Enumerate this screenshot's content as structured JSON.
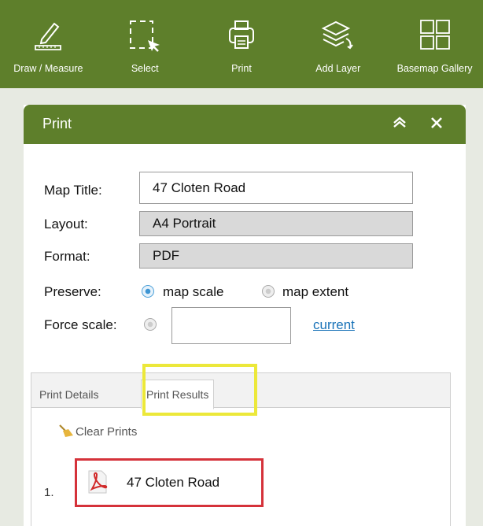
{
  "toolbar": {
    "items": [
      {
        "label": "Draw / Measure",
        "icon": "pencil-ruler-icon"
      },
      {
        "label": "Select",
        "icon": "select-cursor-icon"
      },
      {
        "label": "Print",
        "icon": "printer-icon"
      },
      {
        "label": "Add Layer",
        "icon": "layers-icon"
      },
      {
        "label": "Basemap Gallery",
        "icon": "grid-icon"
      }
    ]
  },
  "panel": {
    "title": "Print",
    "collapse_icon": "double-chevron-up-icon",
    "close_icon": "close-icon",
    "form": {
      "map_title_label": "Map Title:",
      "map_title_value": "47 Cloten Road",
      "layout_label": "Layout:",
      "layout_value": "A4 Portrait",
      "format_label": "Format:",
      "format_value": "PDF",
      "preserve_label": "Preserve:",
      "preserve_options": [
        {
          "label": "map scale",
          "checked": true
        },
        {
          "label": "map extent",
          "checked": false
        }
      ],
      "force_scale_label": "Force scale:",
      "force_scale_value": "",
      "current_link": "current"
    },
    "tabs": [
      {
        "label": "Print Details",
        "active": false
      },
      {
        "label": "Print Results",
        "active": true
      }
    ],
    "results": {
      "clear_label": "Clear Prints",
      "items": [
        {
          "number": "1.",
          "name": "47 Cloten Road",
          "icon": "pdf-icon"
        }
      ]
    }
  },
  "colors": {
    "header_green": "#5e7f2b",
    "highlight_yellow": "#ece83a",
    "highlight_red": "#d5323a",
    "link_blue": "#1a73b8"
  }
}
